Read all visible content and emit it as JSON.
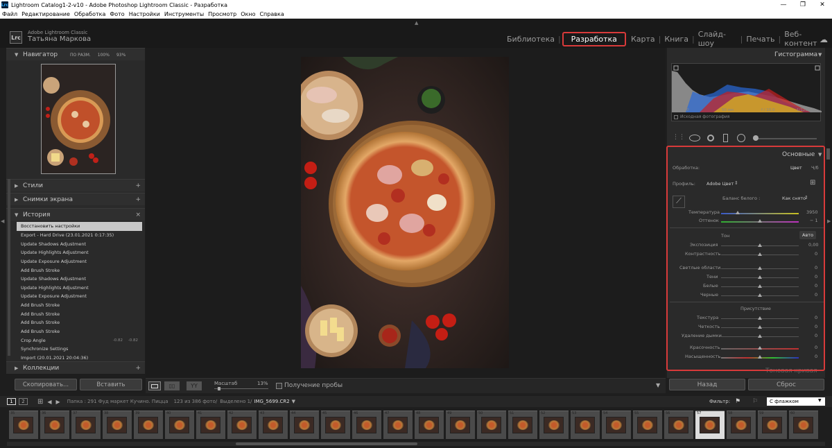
{
  "window": {
    "title": "Lightroom Catalog1-2-v10 - Adobe Photoshop Lightroom Classic - Разработка",
    "app_icon": "Lrc",
    "controls": [
      "—",
      "❐",
      "✕"
    ]
  },
  "menu": [
    "Файл",
    "Редактирование",
    "Обработка",
    "Фото",
    "Настройки",
    "Инструменты",
    "Просмотр",
    "Окно",
    "Справка"
  ],
  "header": {
    "logo": "Lrc",
    "product": "Adobe Lightroom Classic",
    "user": "Татьяна Маркова"
  },
  "modules": [
    {
      "label": "Библиотека",
      "active": false
    },
    {
      "label": "Разработка",
      "active": true
    },
    {
      "label": "Карта",
      "active": false
    },
    {
      "label": "Книга",
      "active": false
    },
    {
      "label": "Слайд-шоу",
      "active": false
    },
    {
      "label": "Печать",
      "active": false
    },
    {
      "label": "Веб-контент",
      "active": false
    }
  ],
  "left": {
    "navigator": {
      "title": "Навигатор",
      "zoom1": "ПО РАЗМ.",
      "zoom2": "100%",
      "zoom3": "93%"
    },
    "presets": "Стили",
    "snapshots": "Снимки экрана",
    "history": {
      "title": "История",
      "items": [
        {
          "label": "Восстановить настройки",
          "selected": true,
          "v1": "",
          "v2": ""
        },
        {
          "label": "Export - Hard Drive (23.01.2021 0:17:35)",
          "v1": "",
          "v2": ""
        },
        {
          "label": "Update Shadows Adjustment",
          "v1": "",
          "v2": ""
        },
        {
          "label": "Update Highlights Adjustment",
          "v1": "",
          "v2": ""
        },
        {
          "label": "Update Exposure Adjustment",
          "v1": "",
          "v2": ""
        },
        {
          "label": "Add Brush Stroke",
          "v1": "",
          "v2": ""
        },
        {
          "label": "Update Shadows Adjustment",
          "v1": "",
          "v2": ""
        },
        {
          "label": "Update Highlights Adjustment",
          "v1": "",
          "v2": ""
        },
        {
          "label": "Update Exposure Adjustment",
          "v1": "",
          "v2": ""
        },
        {
          "label": "Add Brush Stroke",
          "v1": "",
          "v2": ""
        },
        {
          "label": "Add Brush Stroke",
          "v1": "",
          "v2": ""
        },
        {
          "label": "Add Brush Stroke",
          "v1": "",
          "v2": ""
        },
        {
          "label": "Add Brush Stroke",
          "v1": "",
          "v2": ""
        },
        {
          "label": "Crop Angle",
          "v1": "-0.82",
          "v2": "-0.82"
        },
        {
          "label": "Synchronize Settings",
          "v1": "",
          "v2": ""
        },
        {
          "label": "Import (20.01.2021 20:04:36)",
          "v1": "",
          "v2": ""
        }
      ]
    },
    "collections": "Коллекции",
    "copy_btn": "Скопировать...",
    "paste_btn": "Вставить"
  },
  "toolbar": {
    "zoom_label": "Масштаб",
    "zoom_value": "13%",
    "soft_proof": "Получение пробы"
  },
  "right": {
    "histogram": {
      "title": "Гистограмма",
      "iso": "ISO 100",
      "focal": "50 мм",
      "aperture": "f / 10.0",
      "shutter": "1/125 с",
      "original": "Исходная фотография"
    },
    "basic": {
      "title": "Основные",
      "treatment_label": "Обработка:",
      "treatment_color": "Цвет",
      "treatment_bw": "Ч/б",
      "profile_label": "Профиль:",
      "profile_value": "Adobe Цвет",
      "wb_label": "Баланс белого :",
      "wb_value": "Как снято",
      "temp_label": "Температура",
      "temp_value": "3950",
      "tint_label": "Оттенок",
      "tint_value": "− 1",
      "tone_label": "Тон",
      "auto": "Авто",
      "exposure_label": "Экспозиция",
      "exposure_value": "0,00",
      "contrast_label": "Контрастность",
      "contrast_value": "0",
      "highlights_label": "Светлые области",
      "highlights_value": "0",
      "shadows_label": "Тени",
      "shadows_value": "0",
      "whites_label": "Белые",
      "whites_value": "0",
      "blacks_label": "Черные",
      "blacks_value": "0",
      "presence_label": "Присутствие",
      "texture_label": "Текстура",
      "texture_value": "0",
      "clarity_label": "Четкость",
      "clarity_value": "0",
      "dehaze_label": "Удаление дымки",
      "dehaze_value": "0",
      "vibrance_label": "Красочность",
      "vibrance_value": "0",
      "saturation_label": "Насыщенность",
      "saturation_value": "0",
      "tone_curve": "Тоновая кривая"
    },
    "prev_btn": "Назад",
    "reset_btn": "Сброс"
  },
  "filmstrip_bar": {
    "view1": "1",
    "view2": "2",
    "path": "Папка : 291 Фуд маркет Кучино. Пицца",
    "count": "123 из 386 фото/",
    "selected": "Выделено 1/",
    "filename": "IMG_5699.CR2",
    "filter_label": "Фильтр:",
    "filter_value": "С флажком"
  },
  "filmstrip": {
    "numbers": [
      "35",
      "36",
      "37",
      "38",
      "39",
      "40",
      "41",
      "42",
      "43",
      "44",
      "45",
      "46",
      "47",
      "48",
      "49",
      "50",
      "51",
      "52",
      "53",
      "54",
      "55",
      "56",
      "57",
      "58",
      "59",
      "60"
    ],
    "selected_index": 22
  }
}
